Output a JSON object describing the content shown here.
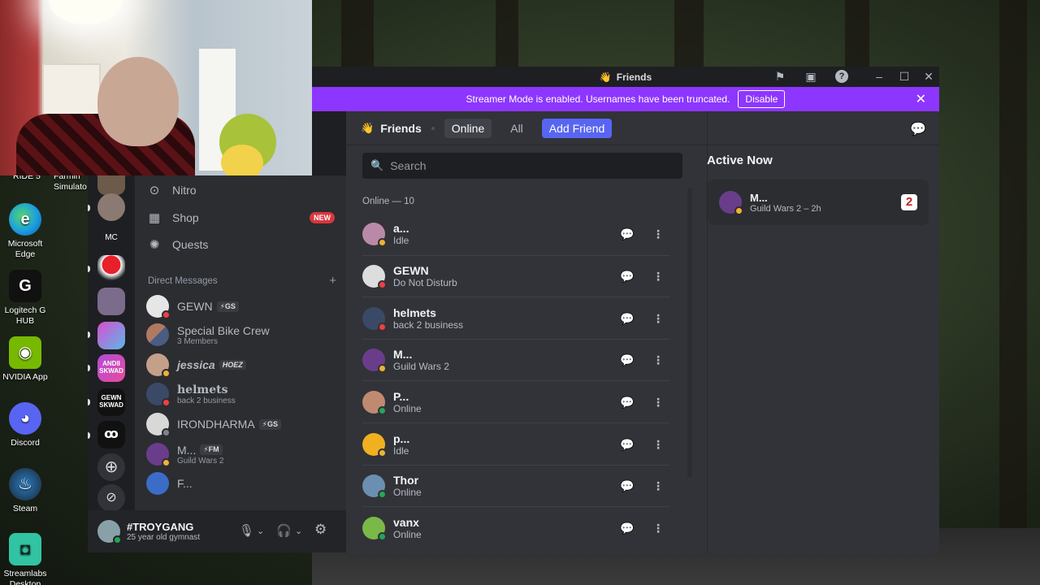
{
  "desktop": {
    "top_labels": [
      "RIDE 5",
      "Farmin Simulato"
    ],
    "icons": [
      {
        "label": "Microsoft Edge",
        "icon": "edge-icon",
        "color": "#1b9de2"
      },
      {
        "label": "Logitech G HUB",
        "icon": "logitech-g-icon",
        "color": "#111111"
      },
      {
        "label": "NVIDIA App",
        "icon": "nvidia-icon",
        "color": "#76b900"
      },
      {
        "label": "Discord",
        "icon": "discord-icon",
        "color": "#5865f2"
      },
      {
        "label": "Steam",
        "icon": "steam-icon",
        "color": "#1b2838"
      },
      {
        "label": "Streamlabs Desktop",
        "icon": "streamlabs-icon",
        "color": "#31c3a2"
      }
    ]
  },
  "window": {
    "title": "Friends",
    "banner": {
      "text": "Streamer Mode is enabled. Usernames have been truncated.",
      "button": "Disable",
      "color": "#8d36ff"
    }
  },
  "sidebar": {
    "nav": [
      {
        "label": "Nitro",
        "icon": "nitro-icon"
      },
      {
        "label": "Shop",
        "icon": "shop-icon",
        "badge": "NEW"
      },
      {
        "label": "Quests",
        "icon": "quests-icon"
      }
    ],
    "dm_header": "Direct Messages",
    "dms": [
      {
        "name": "GEWN",
        "tag": "⚡GS",
        "sub": "",
        "status": "dnd"
      },
      {
        "name": "Special Bike Crew",
        "tag": "",
        "sub": "3 Members",
        "status": ""
      },
      {
        "name": "jessica",
        "tag": "HOEZ",
        "sub": "",
        "status": "idle"
      },
      {
        "name": "helmets",
        "tag": "",
        "sub": "back 2 business",
        "status": "dnd"
      },
      {
        "name": "IRONDHARMA",
        "tag": "⚡GS",
        "sub": "",
        "status": "offline"
      },
      {
        "name": "M...",
        "tag": "⚡FM",
        "sub": "Guild Wars 2",
        "status": "idle"
      },
      {
        "name": "F...",
        "tag": "",
        "sub": "",
        "status": ""
      }
    ],
    "user": {
      "name": "#TROYGANG",
      "status": "25 year old gymnast"
    }
  },
  "header": {
    "title": "Friends",
    "tabs": [
      "Online",
      "All"
    ],
    "add_friend": "Add Friend"
  },
  "search": {
    "placeholder": "Search"
  },
  "online_count": "Online — 10",
  "friends": [
    {
      "name": "a...",
      "status": "Idle",
      "state": "idle",
      "color": "#b98aa8"
    },
    {
      "name": "GEWN",
      "status": "Do Not Disturb",
      "state": "dnd",
      "color": "#dddddd"
    },
    {
      "name": "helmets",
      "status": "back 2 business",
      "state": "dnd",
      "color": "#3a4a66"
    },
    {
      "name": "M...",
      "status": "Guild Wars 2",
      "state": "idle",
      "color": "#6a3d8a"
    },
    {
      "name": "P...",
      "status": "Online",
      "state": "online",
      "color": "#c08a70"
    },
    {
      "name": "p...",
      "status": "Idle",
      "state": "idle",
      "color": "#f0b020"
    },
    {
      "name": "Thor",
      "status": "Online",
      "state": "online",
      "color": "#6a8fb0"
    },
    {
      "name": "vanx",
      "status": "Online",
      "state": "online",
      "color": "#7ab848"
    }
  ],
  "active_now": {
    "title": "Active Now",
    "name": "M...",
    "activity": "Guild Wars 2 – 2h",
    "game_icon": "2"
  },
  "colors": {
    "online": "#23a55a",
    "idle": "#f0b232",
    "dnd": "#f23f43",
    "offline": "#80848e",
    "accent": "#5865f2"
  }
}
